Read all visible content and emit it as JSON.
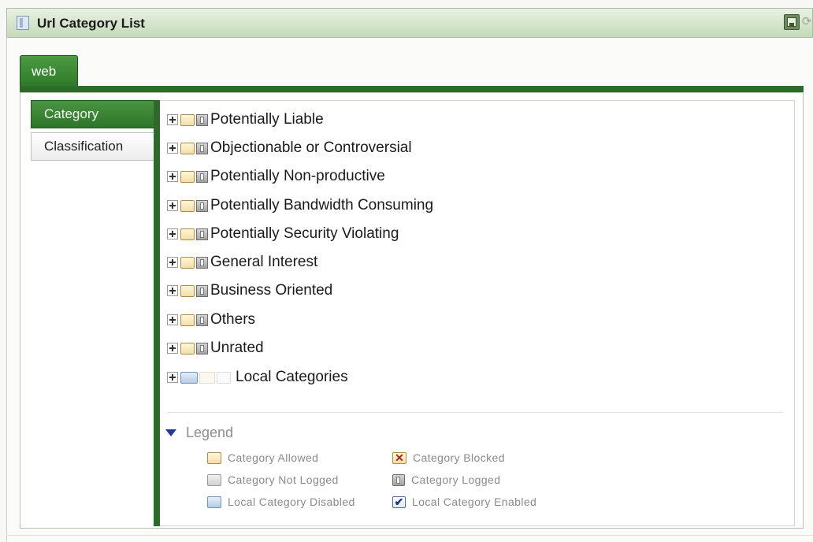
{
  "window": {
    "title": "Url Category List",
    "buttons": {
      "save_icon": "save-icon",
      "refresh_icon": "refresh-icon"
    }
  },
  "tabs": [
    {
      "label": "web",
      "selected": true
    }
  ],
  "side_tabs": [
    {
      "label": "Category",
      "selected": true
    },
    {
      "label": "Classification",
      "selected": false
    }
  ],
  "tree": {
    "items": [
      {
        "label": "Potentially Liable",
        "icons": [
          "category-allowed-icon",
          "category-logged-icon"
        ]
      },
      {
        "label": "Objectionable or Controversial",
        "icons": [
          "category-allowed-icon",
          "category-logged-icon"
        ]
      },
      {
        "label": "Potentially Non-productive",
        "icons": [
          "category-allowed-icon",
          "category-logged-icon"
        ]
      },
      {
        "label": "Potentially Bandwidth Consuming",
        "icons": [
          "category-allowed-icon",
          "category-logged-icon"
        ]
      },
      {
        "label": "Potentially Security Violating",
        "icons": [
          "category-allowed-icon",
          "category-logged-icon"
        ]
      },
      {
        "label": "General Interest",
        "icons": [
          "category-allowed-icon",
          "category-logged-icon"
        ]
      },
      {
        "label": "Business Oriented",
        "icons": [
          "category-allowed-icon",
          "category-logged-icon"
        ]
      },
      {
        "label": "Others",
        "icons": [
          "category-allowed-icon",
          "category-logged-icon"
        ]
      },
      {
        "label": "Unrated",
        "icons": [
          "category-allowed-icon",
          "category-logged-icon"
        ]
      },
      {
        "label": "Local Categories",
        "icons": [
          "local-category-disabled-icon",
          "faint-allowed-icon",
          "faint-logged-icon"
        ]
      }
    ]
  },
  "legend": {
    "title": "Legend",
    "items": [
      {
        "label": "Category Allowed",
        "icon": "category-allowed-icon"
      },
      {
        "label": "Category Blocked",
        "icon": "category-blocked-icon"
      },
      {
        "label": "Category Not Logged",
        "icon": "category-not-logged-icon"
      },
      {
        "label": "Category Logged",
        "icon": "category-logged-icon"
      },
      {
        "label": "Local Category Disabled",
        "icon": "local-category-disabled-icon"
      },
      {
        "label": "Local Category Enabled",
        "icon": "local-category-enabled-icon"
      }
    ]
  },
  "colors": {
    "accent_green": "#2e6b2a",
    "titlebar": "#c5dab8",
    "legend_triangle": "#23389a"
  }
}
